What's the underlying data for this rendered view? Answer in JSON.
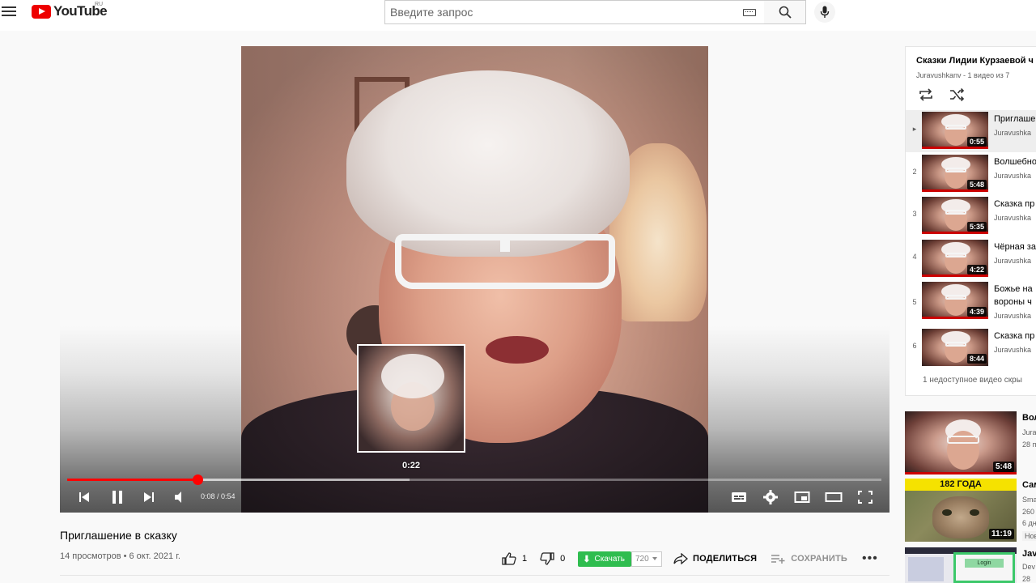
{
  "header": {
    "logo_text": "YouTube",
    "logo_region": "RU",
    "search_placeholder": "Введите запрос"
  },
  "player": {
    "time_current": "0:08",
    "time_total": "0:54",
    "time_display": "0:08 / 0:54",
    "preview_time": "0:22",
    "progress_fraction": 0.16,
    "buffer_fraction": 0.42
  },
  "video": {
    "title": "Приглашение в сказку",
    "meta": "14 просмотров • 6 окт. 2021 г.",
    "likes": "1",
    "dislikes": "0",
    "download_label": "Скачать",
    "quality": "720",
    "share_label": "ПОДЕЛИТЬСЯ",
    "save_label": "СОХРАНИТЬ",
    "more_label": "•••"
  },
  "playlist": {
    "title": "Сказки Лидии Курзаевой ч",
    "subtitle": "Juravushkanv - 1 видео из 7",
    "note": "1 недоступное видео скры",
    "items": [
      {
        "index": "▸",
        "title": "Приглаше",
        "channel": "Juravushka",
        "duration": "0:55",
        "active": true
      },
      {
        "index": "2",
        "title": "Волшебно",
        "channel": "Juravushka",
        "duration": "5:48",
        "active": false
      },
      {
        "index": "3",
        "title": "Сказка пр",
        "channel": "Juravushka",
        "duration": "5:35",
        "active": false
      },
      {
        "index": "4",
        "title": "Чёрная за",
        "channel": "Juravushka",
        "duration": "4:22",
        "active": false
      },
      {
        "index": "5",
        "title": "Божье на вороны ч",
        "channel": "Juravushka",
        "duration": "4:39",
        "active": false
      },
      {
        "index": "6",
        "title": "Сказка пр",
        "channel": "Juravushka",
        "duration": "8:44",
        "active": false
      }
    ]
  },
  "recommended": [
    {
      "title": "Вол",
      "lines": [
        "Jura",
        "28 п"
      ],
      "duration": "5:48",
      "badge": ""
    },
    {
      "title": "Сам",
      "lines": [
        "Sma",
        "260",
        "6 дн"
      ],
      "duration": "11:19",
      "badge": "Нов",
      "banner": "182 ГОДА"
    },
    {
      "title": "Jav",
      "lines": [
        "Dev",
        "28"
      ],
      "duration": "",
      "badge": "",
      "login": "Login"
    }
  ]
}
